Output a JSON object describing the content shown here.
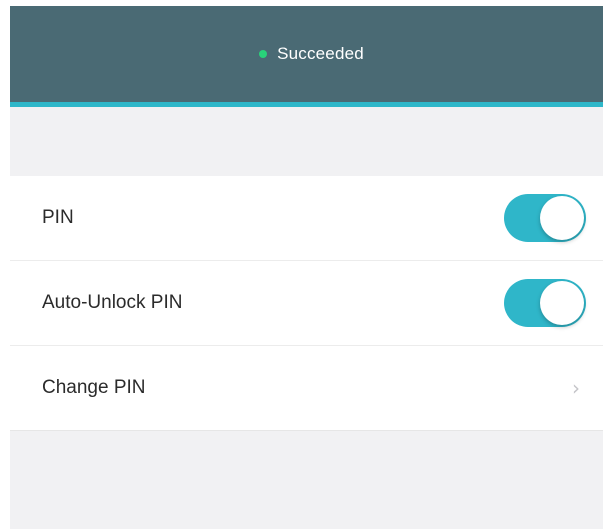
{
  "header": {
    "status_text": "Succeeded",
    "status_color": "#29d27a",
    "background_color": "#4a6a74",
    "accent_color": "#2eb7c9"
  },
  "settings": {
    "items": [
      {
        "label": "PIN",
        "control": "toggle",
        "checked": true
      },
      {
        "label": "Auto-Unlock PIN",
        "control": "toggle",
        "checked": true
      },
      {
        "label": "Change PIN",
        "control": "chevron",
        "icon": "chevron-right-icon"
      }
    ],
    "toggle_on_color": "#2fb6c9"
  }
}
